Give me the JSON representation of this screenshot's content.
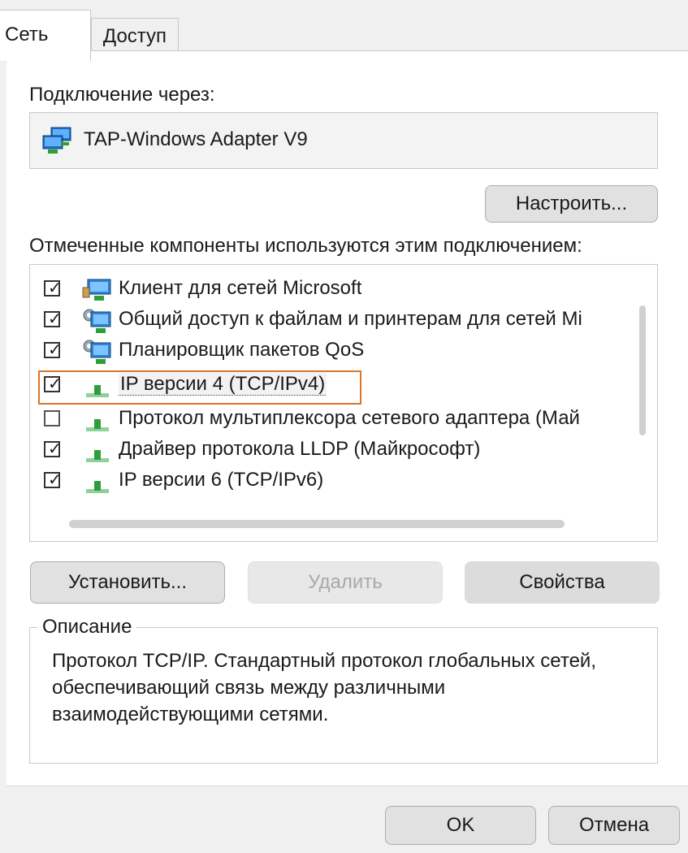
{
  "tabs": [
    {
      "label": "Сеть",
      "active": true
    },
    {
      "label": "Доступ",
      "active": false
    }
  ],
  "connect_using": {
    "label": "Подключение через:",
    "adapter": "TAP-Windows Adapter V9",
    "configure_button": "Настроить..."
  },
  "components": {
    "label": "Отмеченные компоненты используются этим подключением:",
    "items": [
      {
        "label": "Клиент для сетей Microsoft",
        "checked": true,
        "icon": "network-client-icon"
      },
      {
        "label": "Общий доступ к файлам и принтерам для сетей Mi",
        "checked": true,
        "icon": "file-printer-sharing-icon"
      },
      {
        "label": "Планировщик пакетов QoS",
        "checked": true,
        "icon": "qos-scheduler-icon"
      },
      {
        "label": "IP версии 4 (TCP/IPv4)",
        "checked": true,
        "selected": true,
        "icon": "protocol-icon"
      },
      {
        "label": "Протокол мультиплексора сетевого адаптера (Май",
        "checked": false,
        "icon": "protocol-icon"
      },
      {
        "label": "Драйвер протокола LLDP (Майкрософт)",
        "checked": true,
        "icon": "protocol-icon"
      },
      {
        "label": "IP версии 6 (TCP/IPv6)",
        "checked": true,
        "icon": "protocol-icon"
      }
    ]
  },
  "buttons": {
    "install": "Установить...",
    "remove": "Удалить",
    "properties": "Свойства",
    "ok": "OK",
    "cancel": "Отмена"
  },
  "description": {
    "title": "Описание",
    "text": "Протокол TCP/IP. Стандартный протокол глобальных сетей, обеспечивающий связь между различными взаимодействующими сетями."
  },
  "colors": {
    "selection_outline": "#d9752b",
    "protocol_icon_green": "#2e9e3a",
    "monitor_blue": "#2f84d6"
  }
}
